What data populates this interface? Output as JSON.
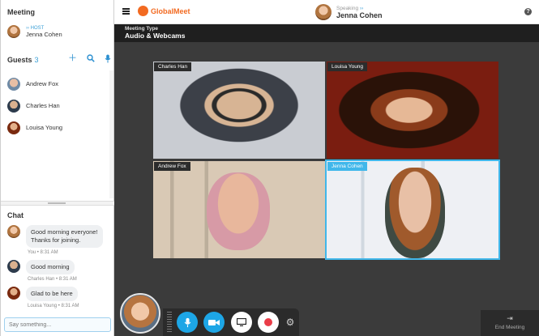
{
  "sidebar": {
    "meeting_title": "Meeting",
    "host": {
      "role_label": "HOST",
      "name": "Jenna Cohen",
      "avatar_icon": "avatar-jenna-icon"
    },
    "guests": {
      "title": "Guests",
      "count": "3",
      "actions": [
        "add-guest-icon",
        "search-icon",
        "mic-icon"
      ],
      "items": [
        {
          "name": "Andrew Fox"
        },
        {
          "name": "Charles Han"
        },
        {
          "name": "Louisa Young"
        }
      ]
    },
    "chat": {
      "title": "Chat",
      "messages": [
        {
          "text": "Good morning everyone! Thanks for joining.",
          "line1": "Good morning everyone!",
          "line2": "Thanks for joining.",
          "meta": "You • 8:31 AM"
        },
        {
          "text": "Good morning",
          "meta": "Charles Han • 8:31 AM"
        },
        {
          "text": "Glad to be here",
          "meta": "Louisa Young • 8:31 AM"
        }
      ],
      "input_placeholder": "Say something..."
    }
  },
  "header": {
    "logo_text": "GlobalMeet",
    "speaking_label": "Speaking",
    "speaking_name": "Jenna Cohen",
    "help_label": "?"
  },
  "meeting_type": {
    "label": "Meeting Type",
    "value": "Audio & Webcams"
  },
  "videos": [
    {
      "name": "Charles Han"
    },
    {
      "name": "Louisa Young"
    },
    {
      "name": "Andrew Fox"
    },
    {
      "name": "Jenna Cohen",
      "active": true
    }
  ],
  "controls": {
    "buttons": [
      "mic-icon",
      "camera-icon",
      "share-screen-icon",
      "record-icon",
      "gear-icon"
    ],
    "end_meeting_label": "End Meeting"
  },
  "colors": {
    "accent": "#1da6e6",
    "brand": "#f26a21",
    "record": "#ea3d48",
    "active_outline": "#41b7ea"
  }
}
